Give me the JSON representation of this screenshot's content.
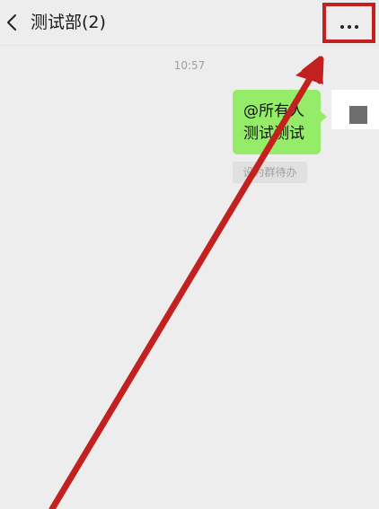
{
  "header": {
    "back_icon": "chevron-left-icon",
    "title": "测试部(2)",
    "more_icon": "more-dots-icon"
  },
  "chat": {
    "timestamp": "10:57",
    "message": {
      "line1": "@所有人",
      "line2": "测试测试"
    },
    "todo_chip": "设为群待办"
  },
  "colors": {
    "background": "#ededed",
    "bubble": "#95ec69",
    "annotation": "#c3211f"
  }
}
